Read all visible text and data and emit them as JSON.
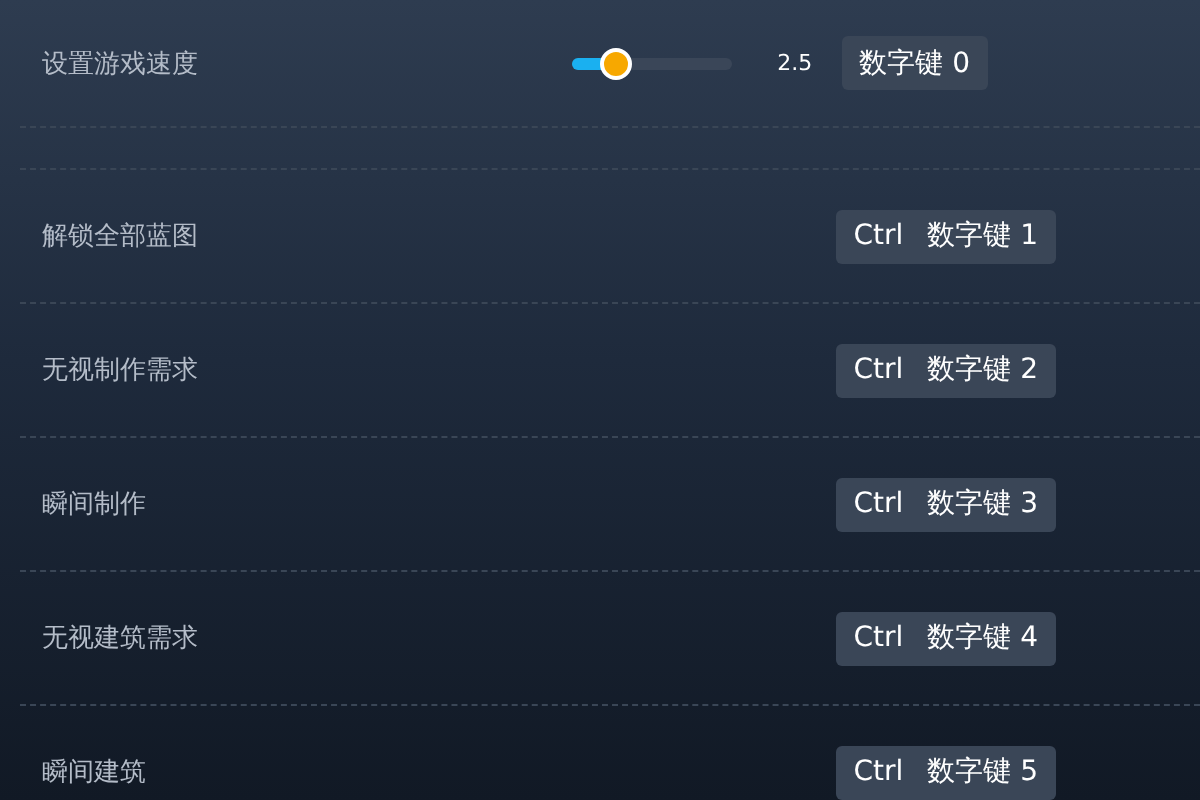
{
  "rows": [
    {
      "kind": "slider",
      "label": "设置游戏速度",
      "level": 0.25,
      "reading": "2.5",
      "keys": [
        "数字键 0"
      ]
    },
    {
      "kind": "spacer"
    },
    {
      "kind": "toggle",
      "label": "解锁全部蓝图",
      "keys": [
        "Ctrl",
        "数字键 1"
      ]
    },
    {
      "kind": "toggle",
      "label": "无视制作需求",
      "keys": [
        "Ctrl",
        "数字键 2"
      ]
    },
    {
      "kind": "toggle",
      "label": "瞬间制作",
      "keys": [
        "Ctrl",
        "数字键 3"
      ]
    },
    {
      "kind": "toggle",
      "label": "无视建筑需求",
      "keys": [
        "Ctrl",
        "数字键 4"
      ]
    },
    {
      "kind": "toggle",
      "label": "瞬间建筑",
      "keys": [
        "Ctrl",
        "数字键 5"
      ]
    }
  ]
}
